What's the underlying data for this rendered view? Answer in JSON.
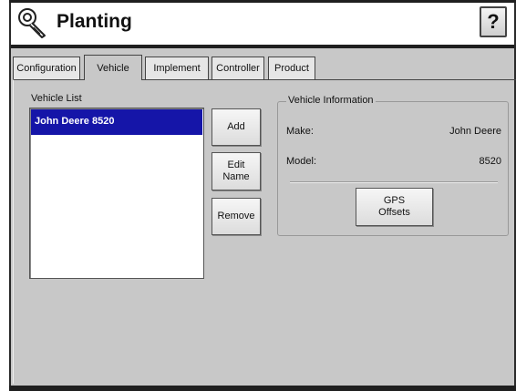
{
  "header": {
    "title": "Planting",
    "help_label": "?"
  },
  "tabs": [
    {
      "label": "Configuration"
    },
    {
      "label": "Vehicle"
    },
    {
      "label": "Implement"
    },
    {
      "label": "Controller"
    },
    {
      "label": "Product"
    }
  ],
  "active_tab": "Vehicle",
  "vehicle_list": {
    "label": "Vehicle List",
    "items": [
      {
        "label": "John Deere 8520",
        "selected": true
      }
    ]
  },
  "buttons": {
    "add": "Add",
    "edit_name": "Edit\nName",
    "remove": "Remove",
    "gps_offsets": "GPS\nOffsets"
  },
  "vehicle_info": {
    "legend": "Vehicle Information",
    "make_label": "Make:",
    "make_value": "John Deere",
    "model_label": "Model:",
    "model_value": "8520"
  },
  "colors": {
    "selection": "#1515a8",
    "background": "#c8c8c8"
  },
  "icons": {
    "app": "wrench-icon"
  }
}
